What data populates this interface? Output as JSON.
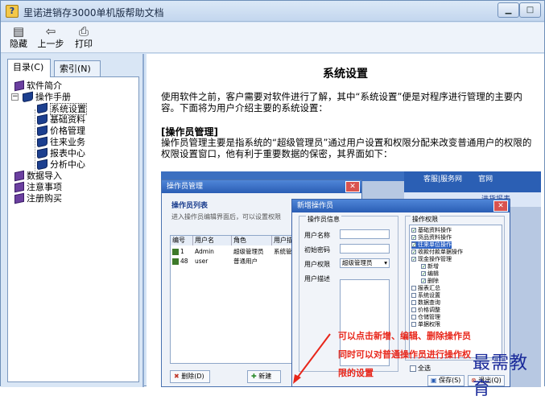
{
  "window": {
    "title": "里诺进销存3000单机版帮助文档",
    "icon": "help-question-icon"
  },
  "toolbar": {
    "hide": "隐藏",
    "back": "上一步",
    "print": "打印"
  },
  "tabs": {
    "contents": "目录(C)",
    "index": "索引(N)"
  },
  "tree": {
    "intro": "软件简介",
    "manual": "操作手册",
    "children": [
      "系统设置",
      "基础资料",
      "价格管理",
      "往来业务",
      "报表中心",
      "分析中心"
    ],
    "data_import": "数据导入",
    "notes": "注意事项",
    "register": "注册购买"
  },
  "content": {
    "title": "系统设置",
    "p1": "使用软件之前，客户需要对软件进行了解，其中“系统设置”便是对程序进行管理的主要内容。下面将为用户介绍主要的系统设置：",
    "h_admin": "[操作员管理]",
    "p2": "操作员管理主要是指系统的“超级管理员”通过用户设置和权限分配来改变普通用户的权限的权限设置窗口，他有利于重要数据的保密，其界面如下："
  },
  "shot": {
    "banner": "客服|服务网",
    "banner_right": "官网",
    "report_tab": "进货报表",
    "dlg1": {
      "title": "操作员管理",
      "sub": "操作员列表",
      "hint": "进入操作员编辑界面后，可以设置权限",
      "cols": [
        "编号",
        "用户名",
        "角色",
        "用户描述"
      ],
      "rows": [
        [
          "1",
          "Admin",
          "超级管理员",
          "系统管理员"
        ],
        [
          "48",
          "user",
          "普通用户",
          ""
        ]
      ],
      "delete": "删除(D)",
      "add": "新建"
    },
    "dlg2": {
      "title": "新增操作员",
      "info": "操作员信息",
      "labels": [
        "用户名称",
        "初始密码",
        "用户权限",
        "用户描述"
      ],
      "role_value": "超级管理员",
      "perm": "操作权限",
      "perms": [
        "基础资料操作",
        "货品资料操作",
        "往来单位操作",
        "收款付款单据操作",
        "现金操作管理",
        "新增",
        "编辑",
        "删除",
        "报表汇总",
        "系统设置",
        "数据查询",
        "价格调整",
        "仓储管理",
        "单据权限"
      ],
      "select_all": "全选",
      "save": "保存(S)",
      "exit": "退出(Q)"
    },
    "annotations": [
      "可以点击新增、编辑、删除操作员",
      "同时可以对普通操作员进行操作权",
      "限的设置"
    ]
  },
  "watermark": "最需教育"
}
